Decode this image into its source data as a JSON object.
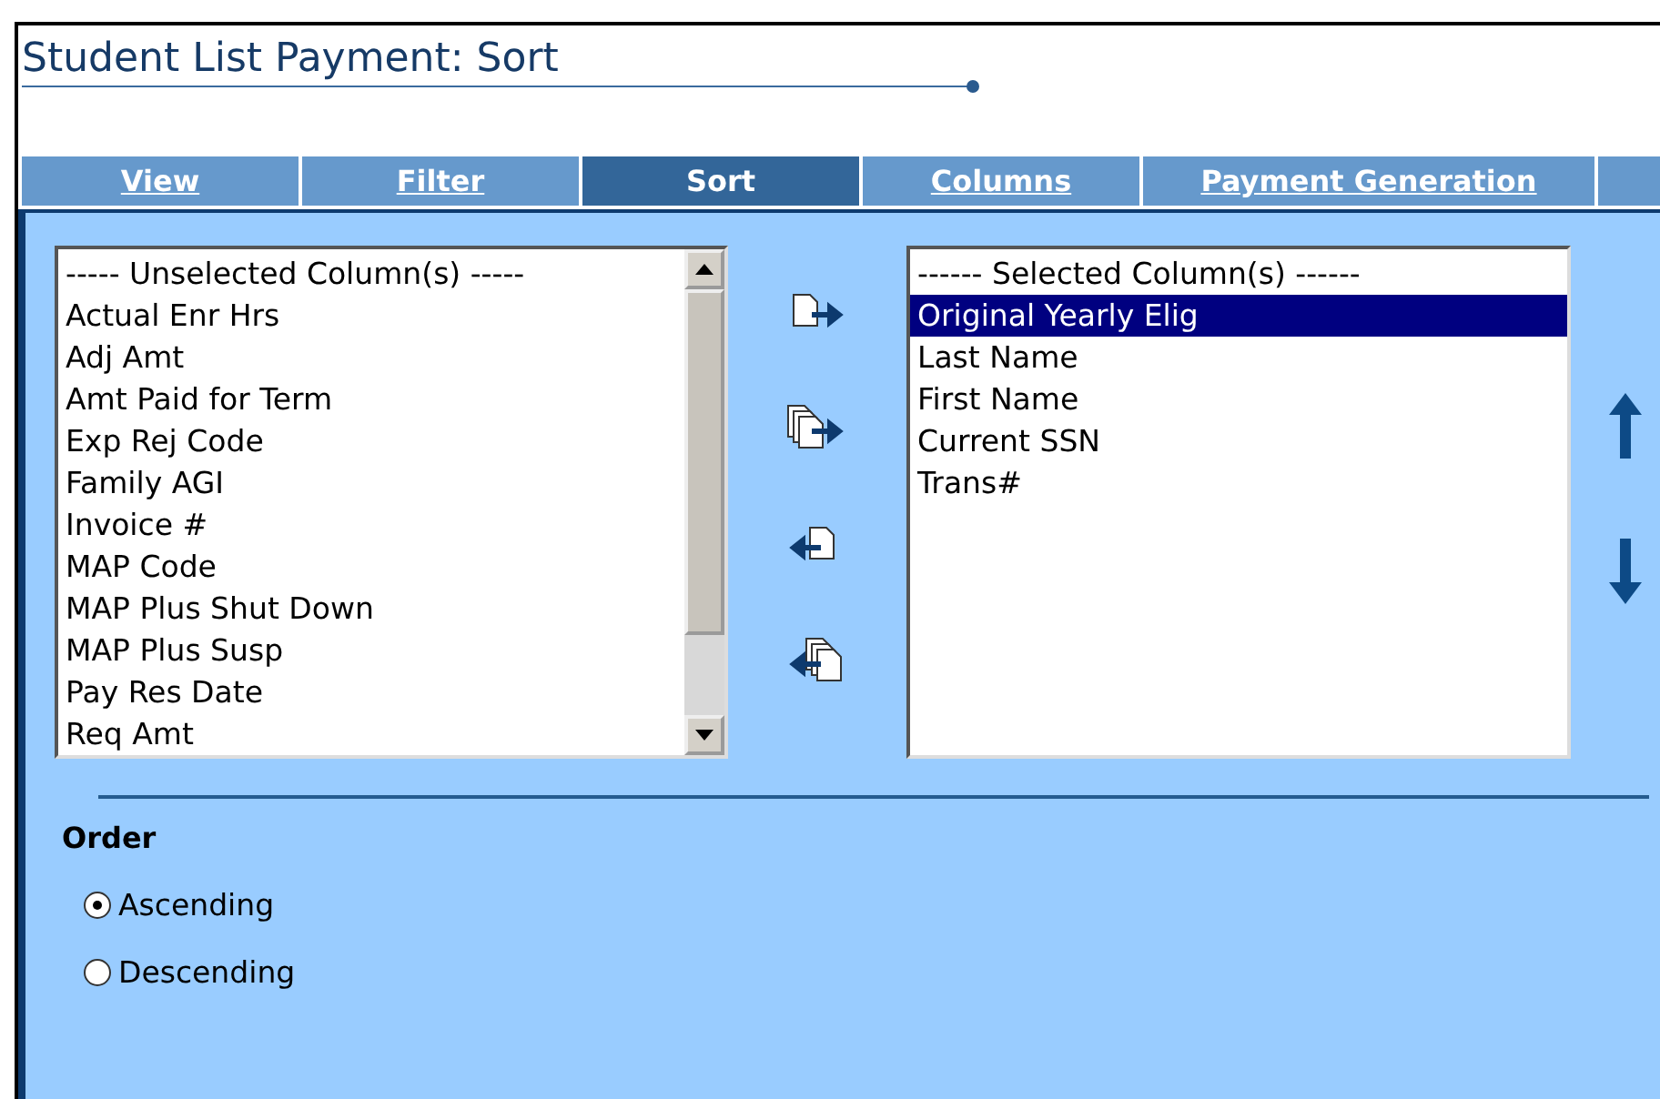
{
  "title": "Student List Payment: Sort",
  "tabs": [
    {
      "label": "View",
      "selected": false
    },
    {
      "label": "Filter",
      "selected": false
    },
    {
      "label": "Sort",
      "selected": true
    },
    {
      "label": "Columns",
      "selected": false
    },
    {
      "label": "Payment Generation",
      "selected": false
    }
  ],
  "unselected_list": {
    "header": "----- Unselected Column(s) -----",
    "items": [
      {
        "label": "Actual Enr Hrs",
        "selected": false
      },
      {
        "label": "Adj Amt",
        "selected": false
      },
      {
        "label": "Amt Paid for Term",
        "selected": false
      },
      {
        "label": "Exp Rej Code",
        "selected": false
      },
      {
        "label": "Family AGI",
        "selected": false
      },
      {
        "label": "Invoice #",
        "selected": false
      },
      {
        "label": "MAP Code",
        "selected": false
      },
      {
        "label": "MAP Plus Shut Down",
        "selected": false
      },
      {
        "label": "MAP Plus Susp",
        "selected": false
      },
      {
        "label": "Pay Res Date",
        "selected": false
      },
      {
        "label": "Req Amt",
        "selected": false
      }
    ]
  },
  "selected_list": {
    "header": "------ Selected Column(s) ------",
    "items": [
      {
        "label": "Original Yearly Elig",
        "selected": true
      },
      {
        "label": "Last Name",
        "selected": false
      },
      {
        "label": "First Name",
        "selected": false
      },
      {
        "label": "Current SSN",
        "selected": false
      },
      {
        "label": "Trans#",
        "selected": false
      }
    ]
  },
  "order": {
    "label": "Order",
    "options": [
      {
        "label": "Ascending",
        "selected": true
      },
      {
        "label": "Descending",
        "selected": false
      }
    ]
  }
}
